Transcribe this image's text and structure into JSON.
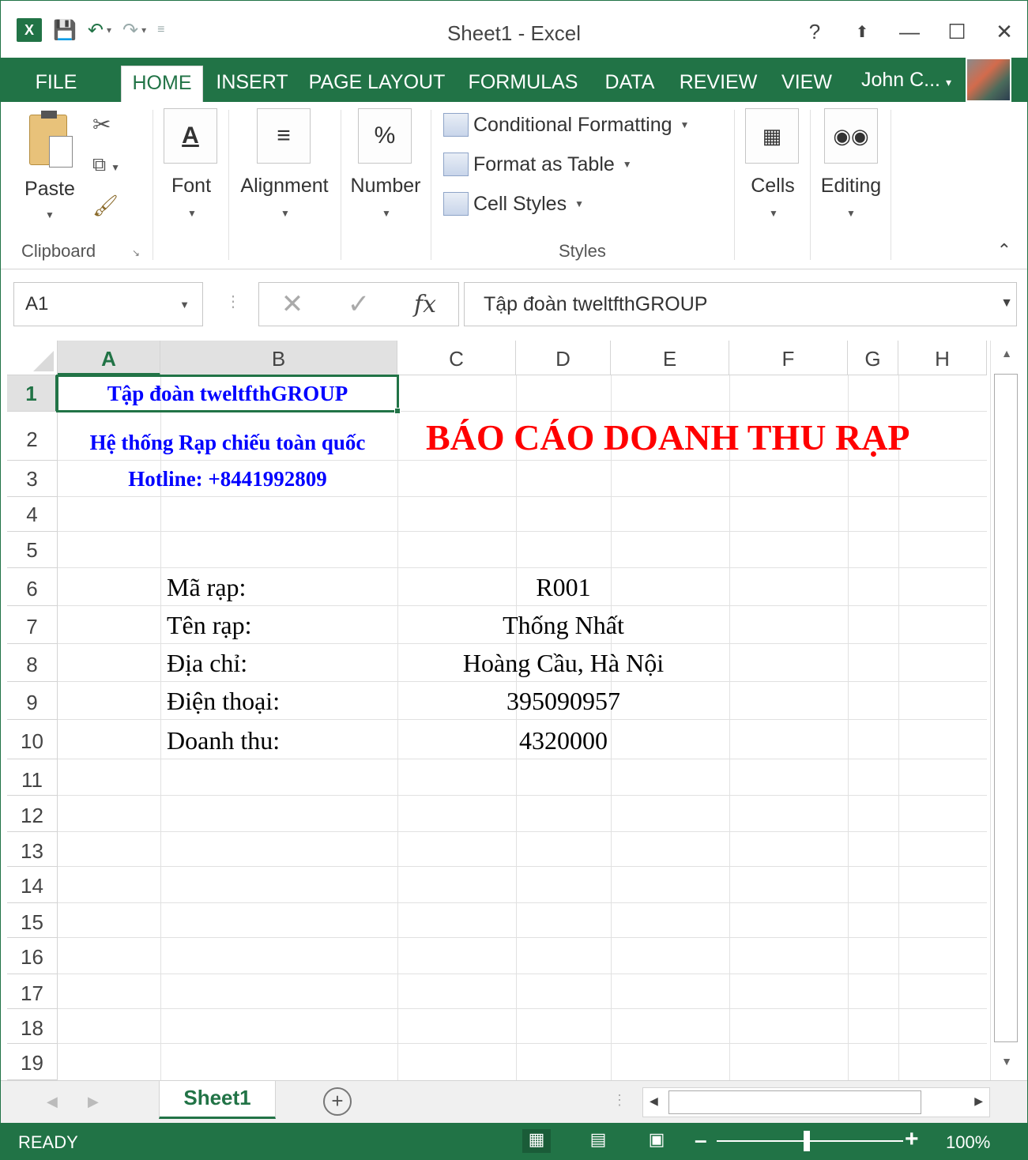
{
  "window": {
    "title": "Sheet1 - Excel",
    "app_icon": "X",
    "controls": [
      "?",
      "⬆",
      "—",
      "☐",
      "✕"
    ]
  },
  "tabs": {
    "file": "FILE",
    "items": [
      "HOME",
      "INSERT",
      "PAGE LAYOUT",
      "FORMULAS",
      "DATA",
      "REVIEW",
      "VIEW"
    ],
    "active": "HOME",
    "user": "John C...",
    "user_caret": "▾"
  },
  "ribbon": {
    "clipboard": {
      "paste": "Paste",
      "group": "Clipboard"
    },
    "font": "Font",
    "alignment": "Alignment",
    "number": "Number",
    "number_icon": "%",
    "styles": {
      "conditional": "Conditional Formatting",
      "format_table": "Format as Table",
      "cell_styles": "Cell Styles",
      "group": "Styles"
    },
    "cells": "Cells",
    "editing": "Editing"
  },
  "formula_bar": {
    "name_box": "A1",
    "fx": "fx",
    "cancel": "✕",
    "enter": "✓",
    "value": "Tập đoàn tweltfthGROUP"
  },
  "columns": [
    "A",
    "B",
    "C",
    "D",
    "E",
    "F",
    "G",
    "H"
  ],
  "selected_column": "A",
  "rows": [
    "1",
    "2",
    "3",
    "4",
    "5",
    "6",
    "7",
    "8",
    "9",
    "10",
    "11",
    "12",
    "13",
    "14",
    "15",
    "16",
    "17",
    "18",
    "19"
  ],
  "selected_row": "1",
  "cells": {
    "A1": "Tập đoàn tweltfthGROUP",
    "A2": "Hệ thống Rạp chiếu toàn quốc",
    "A3": "Hotline: +8441992809",
    "C2": "BÁO CÁO DOANH THU RẠP",
    "B6": "Mã rạp:",
    "B7": "Tên rạp:",
    "B8": "Địa chỉ:",
    "B9": "Điện thoại:",
    "B10": "Doanh thu:",
    "D6": "R001",
    "D7": "Thống Nhất",
    "D8": "Hoàng Cầu, Hà Nội",
    "D9": "395090957",
    "D10": "4320000"
  },
  "sheet_tabs": {
    "active": "Sheet1",
    "add": "+"
  },
  "status": {
    "ready": "READY",
    "zoom": "100%",
    "zoom_level": 1.0
  },
  "colors": {
    "excel_green": "#217346",
    "header_blue": "#0000ff",
    "title_red": "#ff0000"
  }
}
